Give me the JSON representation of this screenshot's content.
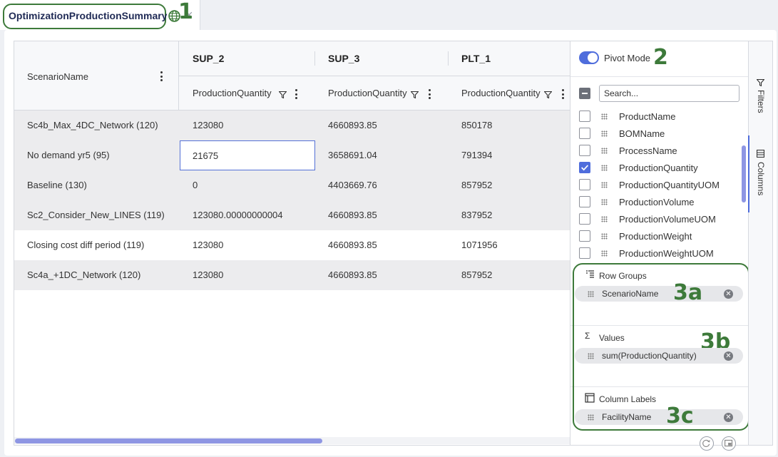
{
  "tab": {
    "title": "OptimizationProductionSummary",
    "close": "×"
  },
  "annotations": {
    "a1": "1",
    "a2": "2",
    "a3a": "3a",
    "a3b": "3b",
    "a3c": "3c"
  },
  "grid": {
    "row_header": "ScenarioName",
    "column_groups": [
      {
        "label": "SUP_2",
        "sub": "ProductionQuantity"
      },
      {
        "label": "SUP_3",
        "sub": "ProductionQuantity"
      },
      {
        "label": "PLT_1",
        "sub": "ProductionQuantity"
      }
    ],
    "rows": [
      {
        "scenario": "Sc4b_Max_4DC_Network (120)",
        "v": [
          "123080",
          "4660893.85",
          "850178"
        ]
      },
      {
        "scenario": "No demand yr5 (95)",
        "v": [
          "21675",
          "3658691.04",
          "791394"
        ]
      },
      {
        "scenario": "Baseline (130)",
        "v": [
          "0",
          "4403669.76",
          "857952"
        ]
      },
      {
        "scenario": "Sc2_Consider_New_LINES (119)",
        "v": [
          "123080.00000000004",
          "4660893.85",
          "837952"
        ]
      },
      {
        "scenario": "Closing cost diff period (119)",
        "v": [
          "123080",
          "4660893.85",
          "1071956"
        ]
      },
      {
        "scenario": "Sc4a_+1DC_Network (120)",
        "v": [
          "123080",
          "4660893.85",
          "857952"
        ]
      }
    ],
    "selected_cell": {
      "row": 1,
      "col": 0
    }
  },
  "panel": {
    "pivot_mode_label": "Pivot Mode",
    "pivot_mode_on": true,
    "search_placeholder": "Search...",
    "columns": [
      {
        "name": "ProductName",
        "checked": false
      },
      {
        "name": "BOMName",
        "checked": false
      },
      {
        "name": "ProcessName",
        "checked": false
      },
      {
        "name": "ProductionQuantity",
        "checked": true
      },
      {
        "name": "ProductionQuantityUOM",
        "checked": false
      },
      {
        "name": "ProductionVolume",
        "checked": false
      },
      {
        "name": "ProductionVolumeUOM",
        "checked": false
      },
      {
        "name": "ProductionWeight",
        "checked": false
      },
      {
        "name": "ProductionWeightUOM",
        "checked": false
      }
    ],
    "row_groups": {
      "title": "Row Groups",
      "item": "ScenarioName"
    },
    "values": {
      "title": "Values",
      "icon": "Σ",
      "item": "sum(ProductionQuantity)"
    },
    "column_labels": {
      "title": "Column Labels",
      "item": "FacilityName"
    }
  },
  "side_tabs": {
    "filters": "Filters",
    "columns": "Columns"
  },
  "colors": {
    "accent": "#4f6ddc",
    "annotation_green": "#3d7a3a",
    "row_alt": "#ececee"
  }
}
